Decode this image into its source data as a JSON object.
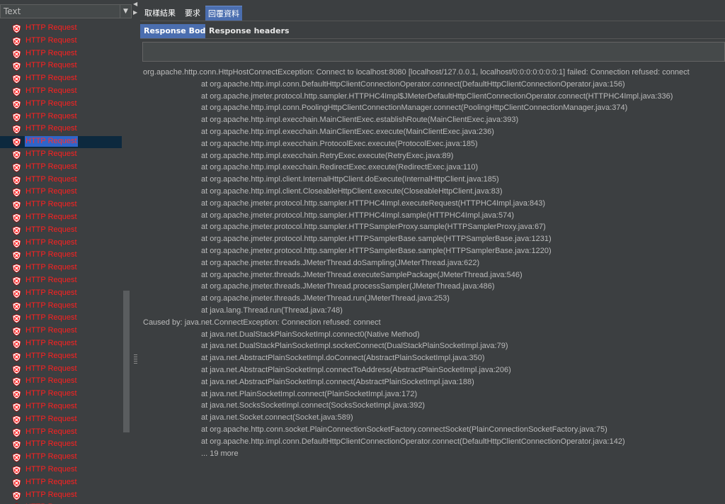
{
  "renderer": {
    "selected": "Text",
    "arrow": "▼"
  },
  "tree": {
    "item_label": "HTTP Request",
    "count": 39,
    "selected_index": 9,
    "status_color": "#ff2020",
    "icon": "error-shield-icon"
  },
  "splitter": {
    "left_arrow": "◀",
    "right_arrow": "▶"
  },
  "tabs": [
    {
      "label": "取樣結果",
      "active": false
    },
    {
      "label": "要求",
      "active": false
    },
    {
      "label": "回覆資料",
      "active": true
    }
  ],
  "subtabs": [
    {
      "label": "Response Body",
      "active": true
    },
    {
      "label": "Response headers",
      "active": false
    }
  ],
  "search": {
    "value": ""
  },
  "response_lines": [
    {
      "text": "org.apache.http.conn.HttpHostConnectException: Connect to localhost:8080 [localhost/127.0.0.1, localhost/0:0:0:0:0:0:0:1] failed: Connection refused: connect",
      "indent": false
    },
    {
      "text": "at org.apache.http.impl.conn.DefaultHttpClientConnectionOperator.connect(DefaultHttpClientConnectionOperator.java:156)",
      "indent": true
    },
    {
      "text": "at org.apache.jmeter.protocol.http.sampler.HTTPHC4Impl$JMeterDefaultHttpClientConnectionOperator.connect(HTTPHC4Impl.java:336)",
      "indent": true
    },
    {
      "text": "at org.apache.http.impl.conn.PoolingHttpClientConnectionManager.connect(PoolingHttpClientConnectionManager.java:374)",
      "indent": true
    },
    {
      "text": "at org.apache.http.impl.execchain.MainClientExec.establishRoute(MainClientExec.java:393)",
      "indent": true
    },
    {
      "text": "at org.apache.http.impl.execchain.MainClientExec.execute(MainClientExec.java:236)",
      "indent": true
    },
    {
      "text": "at org.apache.http.impl.execchain.ProtocolExec.execute(ProtocolExec.java:185)",
      "indent": true
    },
    {
      "text": "at org.apache.http.impl.execchain.RetryExec.execute(RetryExec.java:89)",
      "indent": true
    },
    {
      "text": "at org.apache.http.impl.execchain.RedirectExec.execute(RedirectExec.java:110)",
      "indent": true
    },
    {
      "text": "at org.apache.http.impl.client.InternalHttpClient.doExecute(InternalHttpClient.java:185)",
      "indent": true
    },
    {
      "text": "at org.apache.http.impl.client.CloseableHttpClient.execute(CloseableHttpClient.java:83)",
      "indent": true
    },
    {
      "text": "at org.apache.jmeter.protocol.http.sampler.HTTPHC4Impl.executeRequest(HTTPHC4Impl.java:843)",
      "indent": true
    },
    {
      "text": "at org.apache.jmeter.protocol.http.sampler.HTTPHC4Impl.sample(HTTPHC4Impl.java:574)",
      "indent": true
    },
    {
      "text": "at org.apache.jmeter.protocol.http.sampler.HTTPSamplerProxy.sample(HTTPSamplerProxy.java:67)",
      "indent": true
    },
    {
      "text": "at org.apache.jmeter.protocol.http.sampler.HTTPSamplerBase.sample(HTTPSamplerBase.java:1231)",
      "indent": true
    },
    {
      "text": "at org.apache.jmeter.protocol.http.sampler.HTTPSamplerBase.sample(HTTPSamplerBase.java:1220)",
      "indent": true
    },
    {
      "text": "at org.apache.jmeter.threads.JMeterThread.doSampling(JMeterThread.java:622)",
      "indent": true
    },
    {
      "text": "at org.apache.jmeter.threads.JMeterThread.executeSamplePackage(JMeterThread.java:546)",
      "indent": true
    },
    {
      "text": "at org.apache.jmeter.threads.JMeterThread.processSampler(JMeterThread.java:486)",
      "indent": true
    },
    {
      "text": "at org.apache.jmeter.threads.JMeterThread.run(JMeterThread.java:253)",
      "indent": true
    },
    {
      "text": "at java.lang.Thread.run(Thread.java:748)",
      "indent": true
    },
    {
      "text": "Caused by: java.net.ConnectException: Connection refused: connect",
      "indent": false
    },
    {
      "text": "at java.net.DualStackPlainSocketImpl.connect0(Native Method)",
      "indent": true
    },
    {
      "text": "at java.net.DualStackPlainSocketImpl.socketConnect(DualStackPlainSocketImpl.java:79)",
      "indent": true
    },
    {
      "text": "at java.net.AbstractPlainSocketImpl.doConnect(AbstractPlainSocketImpl.java:350)",
      "indent": true
    },
    {
      "text": "at java.net.AbstractPlainSocketImpl.connectToAddress(AbstractPlainSocketImpl.java:206)",
      "indent": true
    },
    {
      "text": "at java.net.AbstractPlainSocketImpl.connect(AbstractPlainSocketImpl.java:188)",
      "indent": true
    },
    {
      "text": "at java.net.PlainSocketImpl.connect(PlainSocketImpl.java:172)",
      "indent": true
    },
    {
      "text": "at java.net.SocksSocketImpl.connect(SocksSocketImpl.java:392)",
      "indent": true
    },
    {
      "text": "at java.net.Socket.connect(Socket.java:589)",
      "indent": true
    },
    {
      "text": "at org.apache.http.conn.socket.PlainConnectionSocketFactory.connectSocket(PlainConnectionSocketFactory.java:75)",
      "indent": true
    },
    {
      "text": "at org.apache.http.impl.conn.DefaultHttpClientConnectionOperator.connect(DefaultHttpClientConnectionOperator.java:142)",
      "indent": true
    },
    {
      "text": "... 19 more",
      "indent": true
    }
  ]
}
